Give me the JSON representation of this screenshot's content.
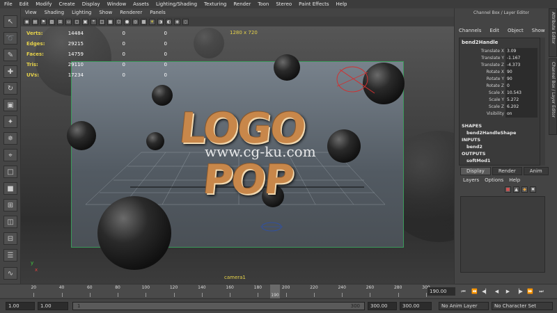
{
  "menubar": [
    "File",
    "Edit",
    "Modify",
    "Create",
    "Display",
    "Window",
    "Assets",
    "Lighting/Shading",
    "Texturing",
    "Render",
    "Toon",
    "Stereo",
    "Paint Effects",
    "Help"
  ],
  "panel_menu": [
    "View",
    "Shading",
    "Lighting",
    "Show",
    "Renderer",
    "Panels"
  ],
  "hud": {
    "rows": [
      {
        "label": "Verts:",
        "value": "14484",
        "a": "0",
        "b": "0"
      },
      {
        "label": "Edges:",
        "value": "29215",
        "a": "0",
        "b": "0"
      },
      {
        "label": "Faces:",
        "value": "14759",
        "a": "0",
        "b": "0"
      },
      {
        "label": "Tris:",
        "value": "29110",
        "a": "0",
        "b": "0"
      },
      {
        "label": "UVs:",
        "value": "17234",
        "a": "0",
        "b": "0"
      }
    ],
    "resolution": "1280 x 720",
    "camera": "camera1"
  },
  "logo": {
    "line1": "LOGO",
    "line2": "POP"
  },
  "watermark": "www.cg-ku.com",
  "channel_box": {
    "title": "Channel Box / Layer Editor",
    "menu": [
      "Channels",
      "Edit",
      "Object",
      "Show"
    ],
    "node": "bend2Handle",
    "attributes": [
      {
        "name": "Translate X",
        "value": "3.09"
      },
      {
        "name": "Translate Y",
        "value": "-1.167"
      },
      {
        "name": "Translate Z",
        "value": "-4.373"
      },
      {
        "name": "Rotate X",
        "value": "90"
      },
      {
        "name": "Rotate Y",
        "value": "90"
      },
      {
        "name": "Rotate Z",
        "value": "0"
      },
      {
        "name": "Scale X",
        "value": "10.543"
      },
      {
        "name": "Scale Y",
        "value": "5.272"
      },
      {
        "name": "Scale Z",
        "value": "6.202"
      },
      {
        "name": "Visibility",
        "value": "on"
      }
    ],
    "shapes_header": "SHAPES",
    "shape_node": "bend2HandleShape",
    "inputs_header": "INPUTS",
    "input_node": "bend2",
    "outputs_header": "OUTPUTS",
    "output_node": "softMod1",
    "side_tabs": [
      "Attribute Editor",
      "Channel Box / Layer Editor"
    ]
  },
  "layer_editor": {
    "tabs": [
      "Display",
      "Render",
      "Anim"
    ],
    "menu": [
      "Layers",
      "Options",
      "Help"
    ]
  },
  "timeline": {
    "ticks": [
      "20",
      "40",
      "60",
      "80",
      "100",
      "120",
      "140",
      "160",
      "180",
      "200",
      "220",
      "240",
      "260",
      "280",
      "300"
    ],
    "current_frame": "190",
    "frame_field": "190.00"
  },
  "range": {
    "start_time": "1.00",
    "playback_start": "1.00",
    "slider_start": "1",
    "slider_end": "300",
    "playback_end": "300.00",
    "end_time": "300.00",
    "anim_layer": "No Anim Layer",
    "character_set": "No Character Set"
  }
}
